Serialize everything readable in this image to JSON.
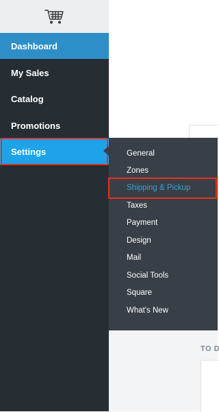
{
  "sidebar": {
    "logo_icon": "shopping-cart-icon",
    "items": [
      {
        "label": "Dashboard"
      },
      {
        "label": "My Sales"
      },
      {
        "label": "Catalog"
      },
      {
        "label": "Promotions"
      },
      {
        "label": "Settings"
      }
    ]
  },
  "submenu": {
    "items": [
      {
        "label": "General"
      },
      {
        "label": "Zones"
      },
      {
        "label": "Shipping & Pickup"
      },
      {
        "label": "Taxes"
      },
      {
        "label": "Payment"
      },
      {
        "label": "Design"
      },
      {
        "label": "Mail"
      },
      {
        "label": "Social Tools"
      },
      {
        "label": "Square"
      },
      {
        "label": "What's New"
      }
    ]
  },
  "content": {
    "section_label": "TO D"
  },
  "colors": {
    "sidebar_bg": "#262d33",
    "dashboard_bg": "#2e8ec7",
    "settings_active_bg": "#1ea3ea",
    "submenu_bg": "#383f46",
    "submenu_active_text": "#3aa0dc",
    "highlight_border": "#e8301c"
  }
}
